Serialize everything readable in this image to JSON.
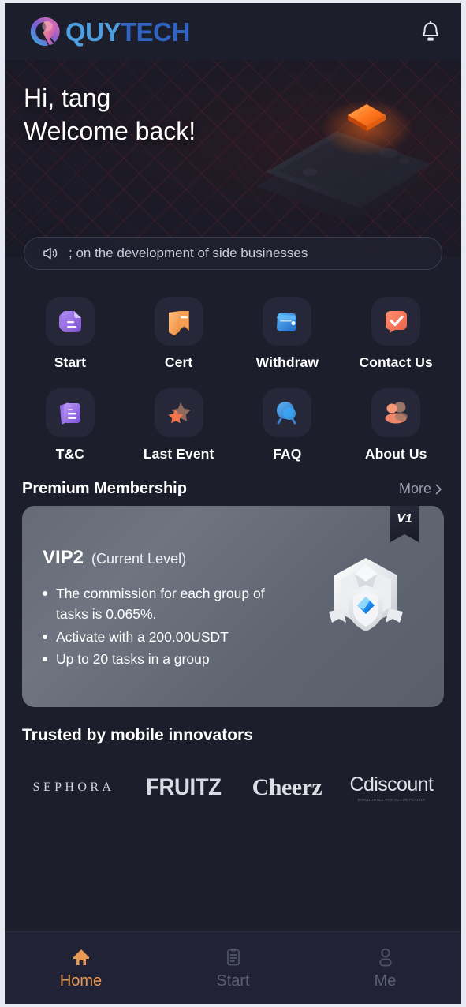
{
  "header": {
    "logo_text_1": "QUY",
    "logo_text_2": "TECH",
    "logo_icon": "quytech-swirl-logo",
    "bell_icon": "notification-bell-icon"
  },
  "hero": {
    "greeting_line1": "Hi, tang",
    "greeting_line2": "Welcome back!",
    "art_icon": "isometric-phone-illustration"
  },
  "announcement": {
    "speaker_icon": "speaker-announcement-icon",
    "text": "; on the development of side businesses"
  },
  "quick_actions": [
    {
      "label": "Start",
      "icon": "document-purple-icon"
    },
    {
      "label": "Cert",
      "icon": "certificate-bookmark-orange-icon"
    },
    {
      "label": "Withdraw",
      "icon": "wallet-blue-icon"
    },
    {
      "label": "Contact Us",
      "icon": "chat-check-coral-icon"
    },
    {
      "label": "T&C",
      "icon": "documents-purple-icon"
    },
    {
      "label": "Last Event",
      "icon": "stars-orange-icon"
    },
    {
      "label": "FAQ",
      "icon": "question-magnifier-blue-icon"
    },
    {
      "label": "About Us",
      "icon": "people-coral-icon"
    }
  ],
  "membership": {
    "section_title": "Premium Membership",
    "more_label": "More",
    "chevron_icon": "chevron-right-icon",
    "ribbon_label": "V1",
    "level": "VIP2",
    "current_level_note": "(Current Level)",
    "emblem_icon": "vip-hexagon-shield-emblem",
    "benefits": [
      "The commission for each group of tasks is 0.065%.",
      "Activate with a 200.00USDT",
      "Up to 20 tasks in a group"
    ]
  },
  "trusted": {
    "title": "Trusted by mobile innovators",
    "brands": [
      {
        "name": "SEPHORA",
        "tagline": ""
      },
      {
        "name": "FRUITZ",
        "tagline": ""
      },
      {
        "name": "Cheerz",
        "tagline": ""
      },
      {
        "name": "Cdiscount",
        "tagline": "DISCOUNTEZ PAS VOTRE PLAISIR"
      }
    ]
  },
  "tabbar": [
    {
      "label": "Home",
      "icon": "home-icon",
      "active": true
    },
    {
      "label": "Start",
      "icon": "clipboard-icon",
      "active": false
    },
    {
      "label": "Me",
      "icon": "person-icon",
      "active": false
    }
  ],
  "colors": {
    "background": "#1d1e2c",
    "tile": "#262739",
    "accent": "#e89a55",
    "card_gray": "#656a76",
    "logo_blue": "#4d9fe0",
    "logo_blue_dark": "#2f63c4",
    "muted_text": "#9b9eae"
  }
}
